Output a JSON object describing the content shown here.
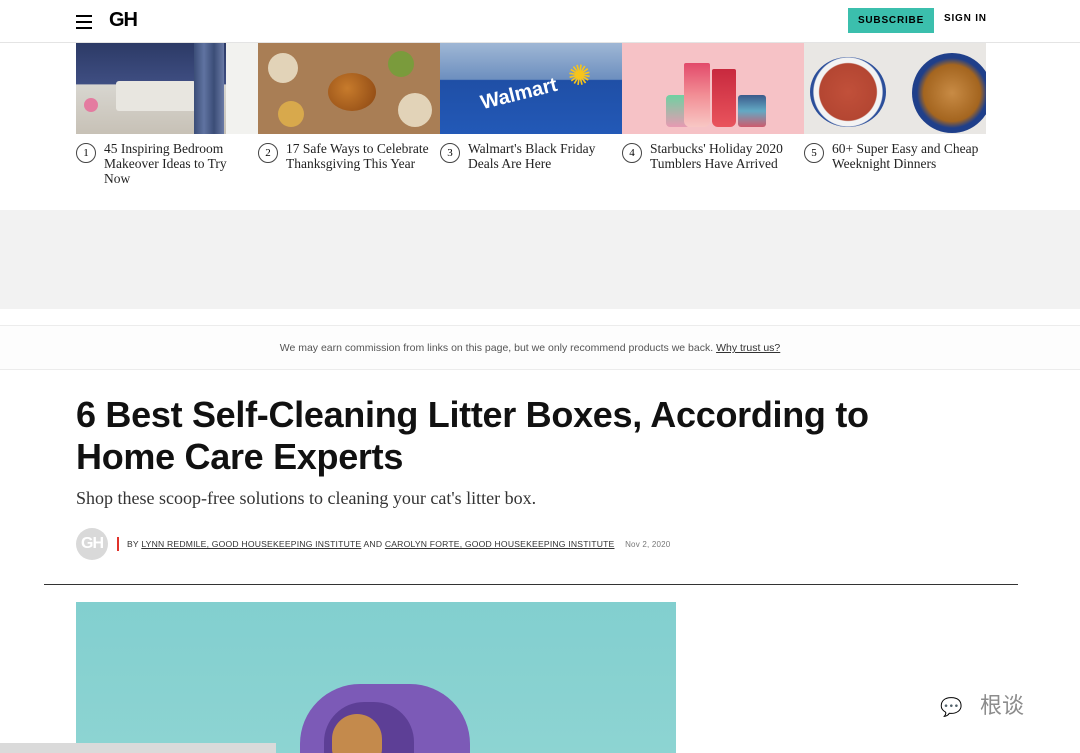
{
  "header": {
    "logo": "GH",
    "subscribe_label": "SUBSCRIBE",
    "signin_label": "SIGN IN"
  },
  "trending": [
    {
      "number": "1",
      "title": "45 Inspiring Bedroom Makeover Ideas to Try Now"
    },
    {
      "number": "2",
      "title": "17 Safe Ways to Celebrate Thanksgiving This Year"
    },
    {
      "number": "3",
      "title": "Walmart's Black Friday Deals Are Here"
    },
    {
      "number": "4",
      "title": "Starbucks' Holiday 2020 Tumblers Have Arrived"
    },
    {
      "number": "5",
      "title": "60+ Super Easy and Cheap Weeknight Dinners"
    }
  ],
  "trending_images": {
    "walmart_sign": "Walmart"
  },
  "disclaimer": {
    "text": "We may earn commission from links on this page, but we only recommend products we back.",
    "link": "Why trust us?"
  },
  "article": {
    "headline": "6 Best Self-Cleaning Litter Boxes, According to Home Care Experts",
    "dek": "Shop these scoop-free solutions to cleaning your cat's litter box.",
    "avatar_text": "GH",
    "byline_prefix": "BY",
    "author1": "LYNN REDMILE, GOOD HOUSEKEEPING INSTITUTE",
    "conjunction": "AND",
    "author2": "CAROLYN FORTE, GOOD HOUSEKEEPING INSTITUTE",
    "date": "Nov 2, 2020"
  },
  "watermark": {
    "text": "根谈"
  },
  "colors": {
    "subscribe_bg": "#3bbfad",
    "byline_accent": "#e0322b",
    "hero_bg": "#82cfcf"
  }
}
